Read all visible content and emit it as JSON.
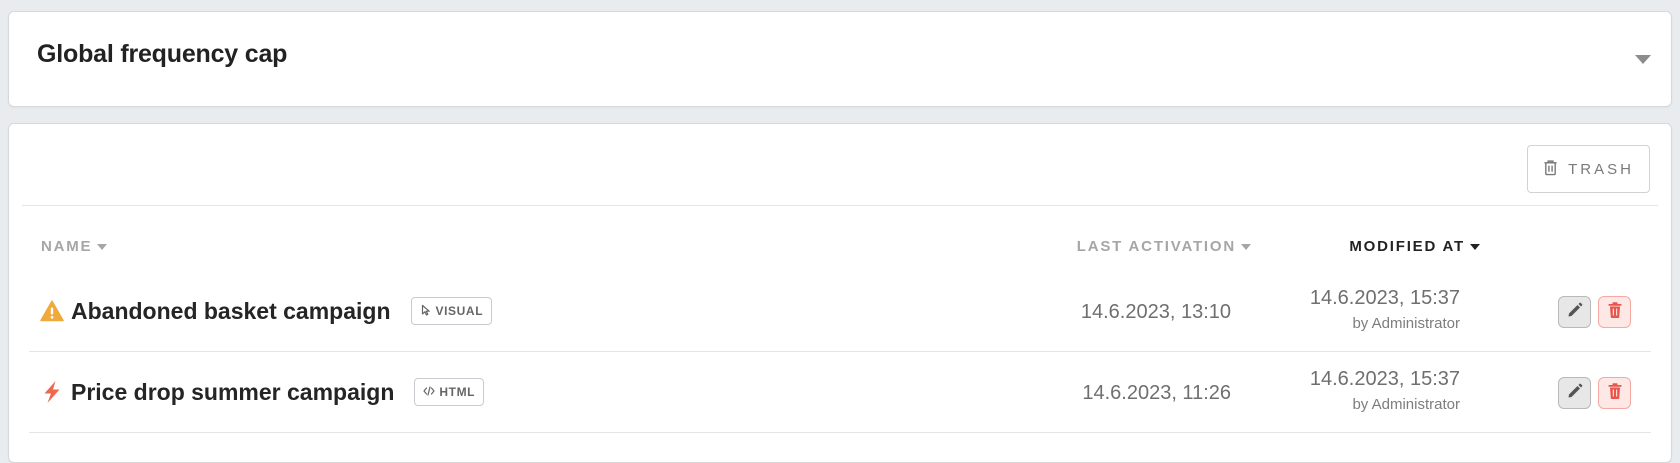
{
  "frequency_panel": {
    "title": "Global frequency cap",
    "expand_icon": "caret-down-icon"
  },
  "toolbar": {
    "trash_label": "TRASH",
    "trash_icon": "trash-icon"
  },
  "table": {
    "columns": [
      {
        "label": "NAME",
        "sort_icon": "caret-down-icon",
        "active": false
      },
      {
        "label": "LAST ACTIVATION",
        "sort_icon": "caret-down-icon",
        "active": false
      },
      {
        "label": "MODIFIED AT",
        "sort_icon": "caret-down-icon",
        "active": true
      }
    ],
    "rows": [
      {
        "status_icon": "warning-icon",
        "status_color": "#f0a93b",
        "name": "Abandoned basket campaign",
        "type_label": "VISUAL",
        "type_icon": "cursor-icon",
        "last_activation": "14.6.2023, 13:10",
        "modified_at": "14.6.2023, 15:37",
        "modified_by": "by Administrator",
        "edit_icon": "pencil-icon",
        "delete_icon": "trash-icon"
      },
      {
        "status_icon": "lightning-icon",
        "status_color": "#f0664f",
        "name": "Price drop summer campaign",
        "type_label": "HTML",
        "type_icon": "code-icon",
        "last_activation": "14.6.2023, 11:26",
        "modified_at": "14.6.2023, 15:37",
        "modified_by": "by Administrator",
        "edit_icon": "pencil-icon",
        "delete_icon": "trash-icon"
      }
    ]
  },
  "colors": {
    "background": "#e9ecef",
    "card": "#ffffff",
    "danger": "#e8554a",
    "warning": "#f0a93b",
    "lightning": "#f0664f"
  }
}
